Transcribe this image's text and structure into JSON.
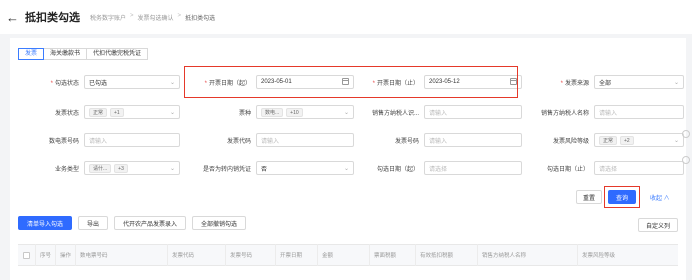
{
  "header": {
    "back_glyph": "←",
    "title": "抵扣类勾选",
    "breadcrumbs": [
      "税务数字账户",
      "发票勾选确认",
      "抵扣类勾选"
    ]
  },
  "tabs": [
    "发票",
    "海关缴款书",
    "代扣代缴完税凭证"
  ],
  "filters": {
    "check_status": {
      "label": "勾选状态",
      "value": "已勾选"
    },
    "issue_date_start": {
      "label": "开票日期（起）",
      "value": "2023-05-01"
    },
    "issue_date_end": {
      "label": "开票日期（止）",
      "value": "2023-05-12"
    },
    "invoice_source": {
      "label": "发票来源",
      "value": "全部"
    },
    "invoice_status": {
      "label": "发票状态",
      "tag": "正常",
      "more": "+1"
    },
    "ticket_type": {
      "label": "票种",
      "tag": "数电...",
      "more": "+10"
    },
    "seller_tax_id": {
      "label": "销售方纳税人识...",
      "placeholder": "请输入"
    },
    "seller_name": {
      "label": "销售方纳税人名称",
      "placeholder": "请输入"
    },
    "digital_invoice_no": {
      "label": "数电票号码",
      "placeholder": "请输入"
    },
    "invoice_code": {
      "label": "发票代码",
      "placeholder": "请输入"
    },
    "invoice_no": {
      "label": "发票号码",
      "placeholder": "请输入"
    },
    "risk_level": {
      "label": "发票风险等级",
      "tag": "正常",
      "more": "+2"
    },
    "business_type": {
      "label": "业务类型",
      "tag": "请什...",
      "more": "+3"
    },
    "is_transfer": {
      "label": "是否为转内销凭证",
      "value": "否"
    },
    "check_date_start": {
      "label": "勾选日期（起）",
      "placeholder": "请选择"
    },
    "check_date_end": {
      "label": "勾选日期（止）",
      "placeholder": "请选择"
    }
  },
  "actions": {
    "reset": "重置",
    "query": "查询",
    "collapse": "收起 ∧"
  },
  "toolbar": [
    "清单导入勾选",
    "导出",
    "代开农产品发票录入",
    "全部撤销勾选"
  ],
  "customize_columns": "自定义列",
  "table_headers": [
    "序号",
    "操作",
    "数电票号码",
    "发票代码",
    "发票号码",
    "开票日期",
    "金额",
    "票面税额",
    "有效抵扣税额",
    "销售方纳税人名称",
    "发票风险等级"
  ],
  "colors": {
    "accent": "#2f6bff",
    "highlight": "#e5392a"
  }
}
